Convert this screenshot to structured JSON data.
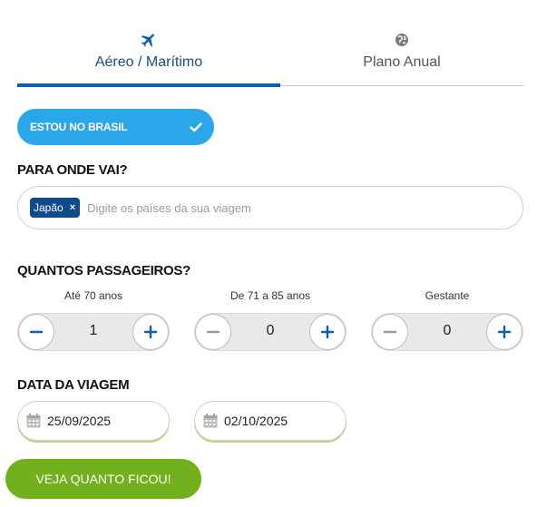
{
  "tabs": [
    {
      "label": "Aéreo / Marítimo",
      "icon": "airplane-icon",
      "active": true
    },
    {
      "label": "Plano Anual",
      "icon": "globe-icon",
      "active": false
    }
  ],
  "location_pill": {
    "label": "ESTOU NO BRASIL",
    "icon": "checkmark-icon",
    "color": "#2aa6ea"
  },
  "destination": {
    "heading": "PARA ONDE VAI?",
    "selected_tags": [
      "Japão"
    ],
    "remove_symbol": "×",
    "placeholder": "Digite os países da sua viagem"
  },
  "passengers": {
    "heading": "QUANTOS PASSAGEIROS?",
    "groups": [
      {
        "label": "Até 70 anos",
        "count": "1"
      },
      {
        "label": "De 71 a 85 anos",
        "count": "0"
      },
      {
        "label": "Gestante",
        "count": "0"
      }
    ]
  },
  "dates": {
    "heading": "DATA DA VIAGEM",
    "departure": "25/09/2025",
    "return": "02/10/2025"
  },
  "cta": {
    "label": "VEJA QUANTO FICOU!",
    "color": "#72b01d"
  },
  "colors": {
    "accent": "#0f5fb0",
    "tag": "#0e4b8c"
  }
}
